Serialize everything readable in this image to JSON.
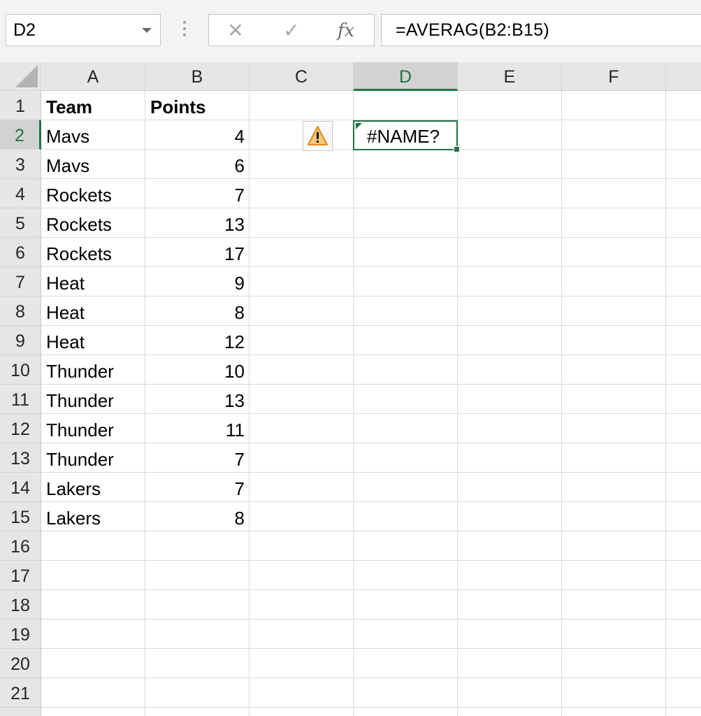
{
  "name_box": {
    "value": "D2"
  },
  "formula_bar": {
    "cancel_glyph": "✕",
    "enter_glyph": "✓",
    "fx_label": "fx",
    "formula": "=AVERAG(B2:B15)"
  },
  "columns": [
    "A",
    "B",
    "C",
    "D",
    "E",
    "F"
  ],
  "active_column": "D",
  "rows": [
    "1",
    "2",
    "3",
    "4",
    "5",
    "6",
    "7",
    "8",
    "9",
    "10",
    "11",
    "12",
    "13",
    "14",
    "15",
    "16",
    "17",
    "18",
    "19",
    "20",
    "21"
  ],
  "active_row": "2",
  "sheet": {
    "header": {
      "team": "Team",
      "points": "Points"
    },
    "data": [
      {
        "team": "Mavs",
        "points": "4"
      },
      {
        "team": "Mavs",
        "points": "6"
      },
      {
        "team": "Rockets",
        "points": "7"
      },
      {
        "team": "Rockets",
        "points": "13"
      },
      {
        "team": "Rockets",
        "points": "17"
      },
      {
        "team": "Heat",
        "points": "9"
      },
      {
        "team": "Heat",
        "points": "8"
      },
      {
        "team": "Heat",
        "points": "12"
      },
      {
        "team": "Thunder",
        "points": "10"
      },
      {
        "team": "Thunder",
        "points": "13"
      },
      {
        "team": "Thunder",
        "points": "11"
      },
      {
        "team": "Thunder",
        "points": "7"
      },
      {
        "team": "Lakers",
        "points": "7"
      },
      {
        "team": "Lakers",
        "points": "8"
      }
    ],
    "selected_cell": {
      "ref": "D2",
      "value": "#NAME?"
    }
  },
  "error_indicator": {
    "icon": "warning-icon",
    "color": "#e8a33d"
  },
  "colors": {
    "accent": "#217346",
    "header_bg": "#e6e6e6",
    "gridline": "#dadada"
  }
}
